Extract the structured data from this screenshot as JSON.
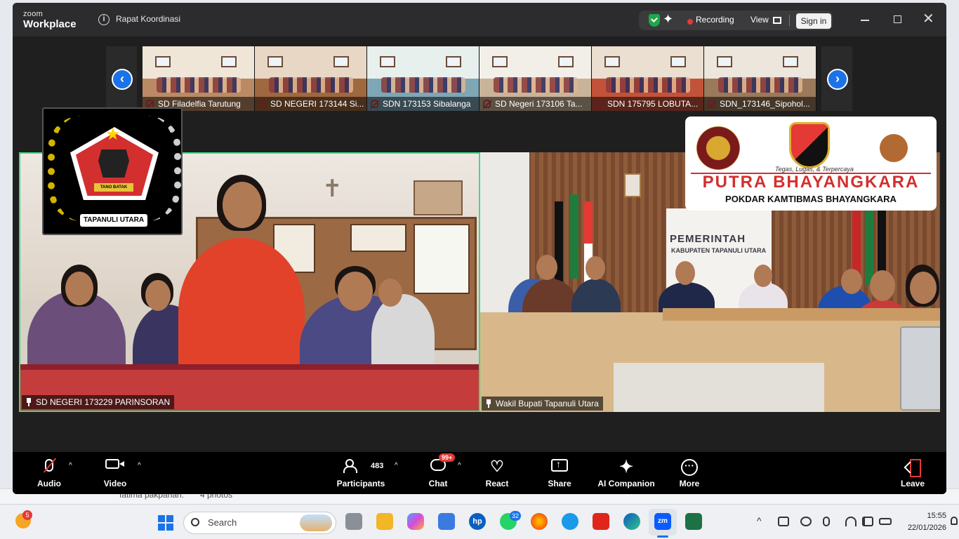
{
  "window": {
    "logo_top": "zoom",
    "logo_bottom": "Workplace",
    "meeting_title": "Rapat Koordinasi",
    "recording_label": "Recording",
    "view_label": "View",
    "sign_in_label": "Sign in"
  },
  "thumbnails": [
    {
      "name": "SD Filadelfia Tarutung"
    },
    {
      "name": "SD NEGERI 173144 Si..."
    },
    {
      "name": "SDN 173153 Sibalanga"
    },
    {
      "name": "SD Negeri 173106 Ta..."
    },
    {
      "name": "SDN 175795 LOBUTA..."
    },
    {
      "name": "SDN_173146_Sipohol..."
    }
  ],
  "main_videos": {
    "left_label": "SD NEGERI 173229 PARINSORAN",
    "right_label": "Wakil Bupati Tapanuli Utara",
    "right_sign_line1": "PEMERINTAH",
    "right_sign_line2": "KABUPATEN TAPANULI UTARA"
  },
  "overlay_logos": {
    "taput_banner": "TAPANULI UTARA",
    "taput_small": "TANO BATAK",
    "putra_tagline": "Tegas, Lugas, & Terpercaya",
    "putra_title": "PUTRA BHAYANGKARA",
    "putra_subtitle": "POKDAR KAMTIBMAS BHAYANGKARA"
  },
  "toolbar": {
    "audio": "Audio",
    "video": "Video",
    "participants": "Participants",
    "participants_count": "483",
    "chat": "Chat",
    "chat_badge": "99+",
    "react": "React",
    "share": "Share",
    "ai_companion": "AI Companion",
    "more": "More",
    "leave": "Leave"
  },
  "background_window": {
    "text1": "fatima pakpahan:",
    "text2": "4 photos"
  },
  "taskbar": {
    "weather_badge": "5",
    "search_placeholder": "Search",
    "whatsapp_badge": "32",
    "time": "15:55",
    "date": "22/01/2026"
  },
  "colors": {
    "zoom_bg": "#1f1f20",
    "active_speaker_border": "#3ddc84",
    "recording_dot": "#e53935",
    "accent_blue": "#1a73e8"
  }
}
